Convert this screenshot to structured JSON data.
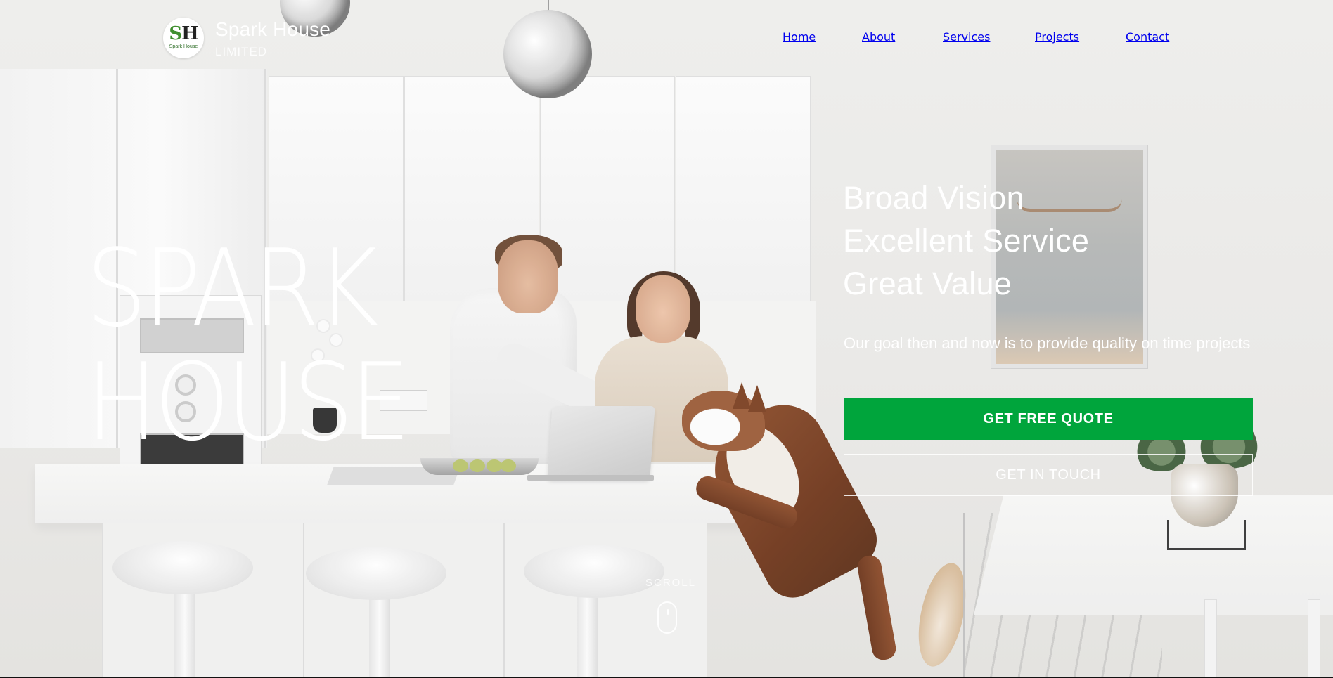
{
  "header": {
    "logo": {
      "mark_s": "S",
      "mark_h": "H",
      "text": "Spark House",
      "icon": "spark-house-logo"
    },
    "brand_name": "Spark House",
    "brand_sub": "LIMITED",
    "nav": [
      "Home",
      "About",
      "Services",
      "Projects",
      "Contact"
    ]
  },
  "hero": {
    "title_line1": "SPARK",
    "title_line2": "HOUSE",
    "taglines": [
      "Broad Vision",
      "Excellent Service",
      "Great Value"
    ],
    "goal": "Our goal then and now is to provide quality on time projects",
    "primary_cta": "GET FREE QUOTE",
    "secondary_cta": "GET IN TOUCH",
    "scroll_label": "SCROLL",
    "scroll_icon": "mouse-scroll-icon"
  },
  "colors": {
    "accent": "#00a53c",
    "text": "#ffffff"
  }
}
